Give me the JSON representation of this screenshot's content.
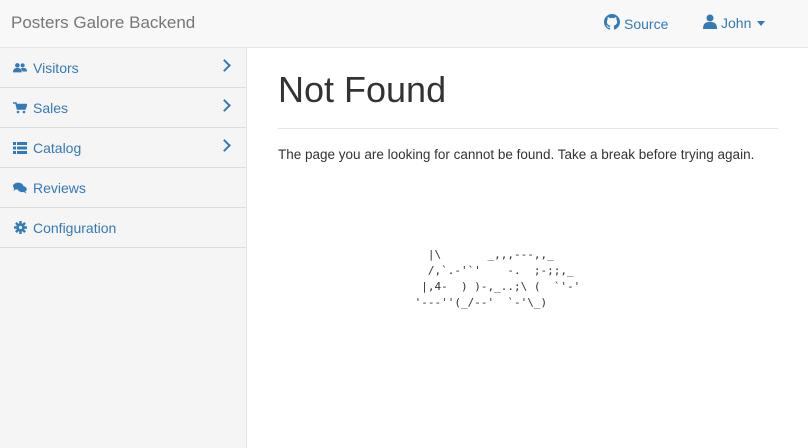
{
  "navbar": {
    "brand": "Posters Galore Backend",
    "source_label": "Source",
    "user_label": "John"
  },
  "sidebar": {
    "items": [
      {
        "label": "Visitors",
        "icon": "users-icon",
        "has_chevron": true
      },
      {
        "label": "Sales",
        "icon": "cart-icon",
        "has_chevron": true
      },
      {
        "label": "Catalog",
        "icon": "list-icon",
        "has_chevron": true
      },
      {
        "label": "Reviews",
        "icon": "comments-icon",
        "has_chevron": false
      },
      {
        "label": "Configuration",
        "icon": "cog-icon",
        "has_chevron": false
      }
    ]
  },
  "main": {
    "title": "Not Found",
    "message": "The page you are looking for cannot be found. Take a break before trying again.",
    "ascii_art": "   |\\       _,,,---,,_\n   /,`.-'`'    -.  ;-;;,_\n  |,4-  ) )-,_..;\\ (  `'-'\n '---''(_/--'  `-'\\_)"
  },
  "colors": {
    "link": "#337ab7",
    "navbar_bg": "#f8f8f8",
    "sidebar_bg": "#f5f5f5"
  }
}
